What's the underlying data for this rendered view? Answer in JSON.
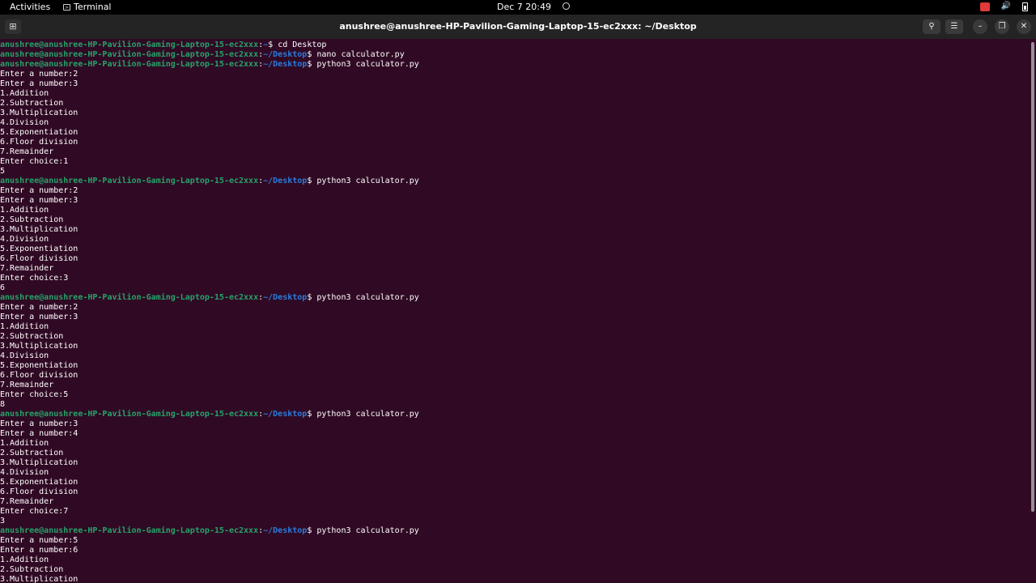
{
  "topbar": {
    "activities": "Activities",
    "app_name": "Terminal",
    "datetime": "Dec 7  20:49"
  },
  "window": {
    "title": "anushree@anushree-HP-Pavilion-Gaming-Laptop-15-ec2xxx: ~/Desktop"
  },
  "terminal": {
    "user_host": "anushree@anushree-HP-Pavilion-Gaming-Laptop-15-ec2xxx",
    "lines": [
      {
        "type": "prompt",
        "path": "~",
        "cmd": "cd Desktop"
      },
      {
        "type": "prompt",
        "path": "~/Desktop",
        "cmd": "nano calculator.py"
      },
      {
        "type": "prompt",
        "path": "~/Desktop",
        "cmd": "python3 calculator.py"
      },
      {
        "type": "out",
        "text": "Enter a number:2"
      },
      {
        "type": "out",
        "text": "Enter a number:3"
      },
      {
        "type": "out",
        "text": "1.Addition"
      },
      {
        "type": "out",
        "text": "2.Subtraction"
      },
      {
        "type": "out",
        "text": "3.Multiplication"
      },
      {
        "type": "out",
        "text": "4.Division"
      },
      {
        "type": "out",
        "text": "5.Exponentiation"
      },
      {
        "type": "out",
        "text": "6.Floor division"
      },
      {
        "type": "out",
        "text": "7.Remainder"
      },
      {
        "type": "out",
        "text": "Enter choice:1"
      },
      {
        "type": "out",
        "text": "5"
      },
      {
        "type": "prompt",
        "path": "~/Desktop",
        "cmd": "python3 calculator.py"
      },
      {
        "type": "out",
        "text": "Enter a number:2"
      },
      {
        "type": "out",
        "text": "Enter a number:3"
      },
      {
        "type": "out",
        "text": "1.Addition"
      },
      {
        "type": "out",
        "text": "2.Subtraction"
      },
      {
        "type": "out",
        "text": "3.Multiplication"
      },
      {
        "type": "out",
        "text": "4.Division"
      },
      {
        "type": "out",
        "text": "5.Exponentiation"
      },
      {
        "type": "out",
        "text": "6.Floor division"
      },
      {
        "type": "out",
        "text": "7.Remainder"
      },
      {
        "type": "out",
        "text": "Enter choice:3"
      },
      {
        "type": "out",
        "text": "6"
      },
      {
        "type": "prompt",
        "path": "~/Desktop",
        "cmd": "python3 calculator.py"
      },
      {
        "type": "out",
        "text": "Enter a number:2"
      },
      {
        "type": "out",
        "text": "Enter a number:3"
      },
      {
        "type": "out",
        "text": "1.Addition"
      },
      {
        "type": "out",
        "text": "2.Subtraction"
      },
      {
        "type": "out",
        "text": "3.Multiplication"
      },
      {
        "type": "out",
        "text": "4.Division"
      },
      {
        "type": "out",
        "text": "5.Exponentiation"
      },
      {
        "type": "out",
        "text": "6.Floor division"
      },
      {
        "type": "out",
        "text": "7.Remainder"
      },
      {
        "type": "out",
        "text": "Enter choice:5"
      },
      {
        "type": "out",
        "text": "8"
      },
      {
        "type": "prompt",
        "path": "~/Desktop",
        "cmd": "python3 calculator.py"
      },
      {
        "type": "out",
        "text": "Enter a number:3"
      },
      {
        "type": "out",
        "text": "Enter a number:4"
      },
      {
        "type": "out",
        "text": "1.Addition"
      },
      {
        "type": "out",
        "text": "2.Subtraction"
      },
      {
        "type": "out",
        "text": "3.Multiplication"
      },
      {
        "type": "out",
        "text": "4.Division"
      },
      {
        "type": "out",
        "text": "5.Exponentiation"
      },
      {
        "type": "out",
        "text": "6.Floor division"
      },
      {
        "type": "out",
        "text": "7.Remainder"
      },
      {
        "type": "out",
        "text": "Enter choice:7"
      },
      {
        "type": "out",
        "text": "3"
      },
      {
        "type": "prompt",
        "path": "~/Desktop",
        "cmd": "python3 calculator.py"
      },
      {
        "type": "out",
        "text": "Enter a number:5"
      },
      {
        "type": "out",
        "text": "Enter a number:6"
      },
      {
        "type": "out",
        "text": "1.Addition"
      },
      {
        "type": "out",
        "text": "2.Subtraction"
      },
      {
        "type": "out",
        "text": "3.Multiplication"
      }
    ]
  },
  "colors": {
    "terminal_bg": "#300a24",
    "user": "#26a269",
    "path": "#2a7bde",
    "text": "#ffffff"
  }
}
